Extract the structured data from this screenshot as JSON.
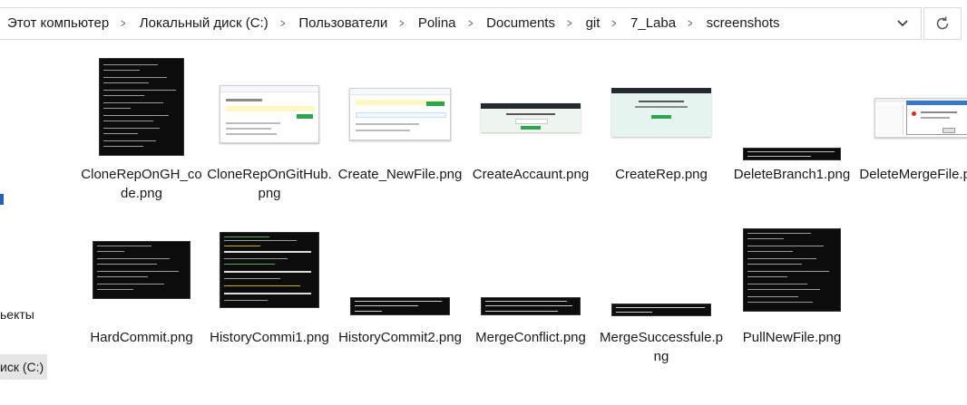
{
  "breadcrumb": [
    "Этот компьютер",
    "Локальный диск (C:)",
    "Пользователи",
    "Polina",
    "Documents",
    "git",
    "7_Laba",
    "screenshots"
  ],
  "nav": {
    "partial_1": "ьекты",
    "partial_2": "иск (C:)"
  },
  "files": [
    {
      "name": "CloneRepOnGH_code.png",
      "kind": "term"
    },
    {
      "name": "CloneRepOnGitHub.png",
      "kind": "web"
    },
    {
      "name": "Create_NewFile.png",
      "kind": "web"
    },
    {
      "name": "CreateAccaunt.png",
      "kind": "web"
    },
    {
      "name": "CreateRep.png",
      "kind": "web"
    },
    {
      "name": "DeleteBranch1.png",
      "kind": "term"
    },
    {
      "name": "DeleteMergeFile.png",
      "kind": "web"
    },
    {
      "name": "HardCommit.png",
      "kind": "term"
    },
    {
      "name": "HistoryCommi1.png",
      "kind": "term"
    },
    {
      "name": "HistoryCommit2.png",
      "kind": "term"
    },
    {
      "name": "MergeConflict.png",
      "kind": "term"
    },
    {
      "name": "MergeSuccessfule.png",
      "kind": "term"
    },
    {
      "name": "PullNewFile.png",
      "kind": "term"
    }
  ],
  "colors": {
    "accent": "#2b5fb8",
    "terminal_bg": "#0c0c0c",
    "github_green": "#2ea44f"
  }
}
